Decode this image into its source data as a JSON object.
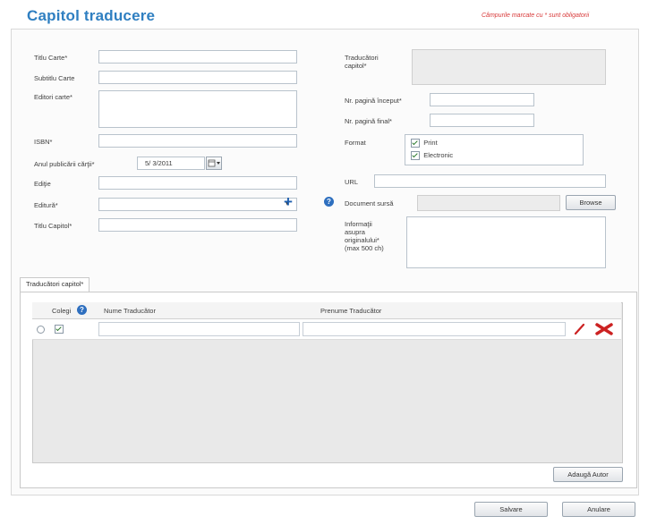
{
  "header": {
    "title": "Capitol traducere",
    "required_note": "Câmpurile marcate cu * sunt obligatorii"
  },
  "form_left": {
    "titlu_carte_label": "Titlu Carte*",
    "subtitlu_carte_label": "Subtitlu Carte",
    "editori_carte_label": "Editori carte*",
    "isbn_label": "ISBN*",
    "anul_label": "Anul publicării cărţii*",
    "anul_value": "5/ 3/2011",
    "editie_label": "Ediţie",
    "editura_label": "Editură*",
    "titlu_capitol_label": "Titlu Capitol*"
  },
  "form_right": {
    "traducatori_label": "Traducători capitol*",
    "nr_pag_inceput_label": "Nr. pagină început*",
    "nr_pag_final_label": "Nr. pagină final*",
    "format_label": "Format",
    "format_options": [
      "Print",
      "Electronic"
    ],
    "url_label": "URL",
    "document_sursa_label": "Document sursă",
    "browse_label": "Browse",
    "informatii_label": "Informaţii asupra originalului* (max 500 ch)"
  },
  "tab": {
    "label": "Traducători capitol*",
    "columns": [
      "Colegi",
      "Nume Traducător",
      "Prenume Traducător"
    ],
    "add_author_label": "Adaugă Autor"
  },
  "footer": {
    "save_label": "Salvare",
    "cancel_label": "Anulare"
  },
  "colors": {
    "title": "#2f7fc1",
    "required_note": "#d83a3a",
    "accent_icon": "#1f5fae",
    "delete_icon": "#cc2222"
  },
  "icons": [
    "plus-icon",
    "info-icon",
    "calendar-icon",
    "edit-icon",
    "delete-icon",
    "checkbox-icon"
  ]
}
